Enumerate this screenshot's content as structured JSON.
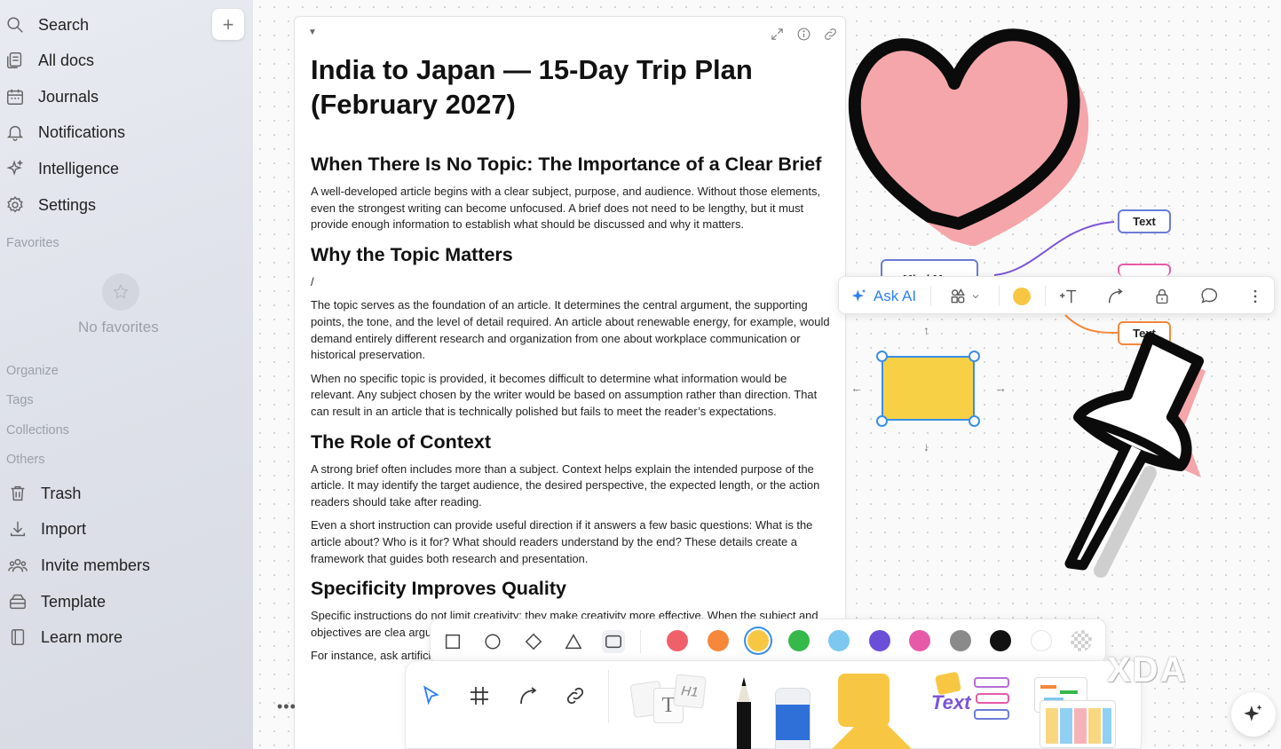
{
  "sidebar": {
    "nav": [
      {
        "label": "Search",
        "icon": "search-icon"
      },
      {
        "label": "All docs",
        "icon": "all-docs-icon"
      },
      {
        "label": "Journals",
        "icon": "calendar-icon"
      },
      {
        "label": "Notifications",
        "icon": "bell-icon"
      },
      {
        "label": "Intelligence",
        "icon": "sparkle-icon"
      },
      {
        "label": "Settings",
        "icon": "gear-icon"
      }
    ],
    "new_button": "+",
    "favorites_heading": "Favorites",
    "favorites_empty": "No favorites",
    "organize_heading": "Organize",
    "tags_heading": "Tags",
    "collections_heading": "Collections",
    "others_heading": "Others",
    "others": [
      {
        "label": "Trash",
        "icon": "trash-icon"
      },
      {
        "label": "Import",
        "icon": "import-icon"
      },
      {
        "label": "Invite members",
        "icon": "members-icon"
      },
      {
        "label": "Template",
        "icon": "template-icon"
      },
      {
        "label": "Learn more",
        "icon": "book-icon"
      }
    ]
  },
  "doc": {
    "title": "India to Japan — 15-Day Trip Plan (February 2027)",
    "h1": "When There Is No Topic: The Importance of a Clear Brief",
    "p1": "A well-developed article begins with a clear subject, purpose, and audience. Without those elements, even the strongest writing can become unfocused. A brief does not need to be lengthy, but it must provide enough information to establish what should be discussed and why it matters.",
    "h2": "Why the Topic Matters",
    "slash": "/",
    "p2": "The topic serves as the foundation of an article. It determines the central argument, the supporting points, the tone, and the level of detail required. An article about renewable energy, for example, would demand entirely different research and organization from one about workplace communication or historical preservation.",
    "p3": "When no specific topic is provided, it becomes difficult to determine what information would be relevant. Any subject chosen by the writer would be based on assumption rather than direction. That can result in an article that is technically polished but fails to meet the reader’s expectations.",
    "h3": "The Role of Context",
    "p4": "A strong brief often includes more than a subject. Context helps explain the intended purpose of the article. It may identify the target audience, the desired perspective, the expected length, or the action readers should take after reading.",
    "p5": "Even a short instruction can provide useful direction if it answers a few basic questions: What is the article about? Who is it for? What should readers understand by the end? These details create a framework that guides both research and presentation.",
    "h4": "Specificity Improves Quality",
    "p6": "Specific instructions do not limit creativity; they make creativity more effective. When the subject and objectives are clea arguments, and create",
    "p7": "For instance, ask artificial intellige the writer to focu wandering into u"
  },
  "mindmap": {
    "root": "Mind Map",
    "node1": "Text",
    "node3": "Text"
  },
  "float_toolbar": {
    "ask_ai": "Ask AI",
    "fill_color": "#f7c744"
  },
  "colors": {
    "swatches": [
      "#f0606b",
      "#f5883a",
      "#f7c744",
      "#36b84a",
      "#7cc8f0",
      "#6b4fd8",
      "#e65aa8",
      "#8a8a8a",
      "#111111",
      "#ffffff"
    ],
    "selected": "#f7c744",
    "accent": "#3a8ee6"
  },
  "bottom_bar": {
    "text_card_label": "H1",
    "text_sticker": "Text"
  },
  "watermark": "XDA"
}
